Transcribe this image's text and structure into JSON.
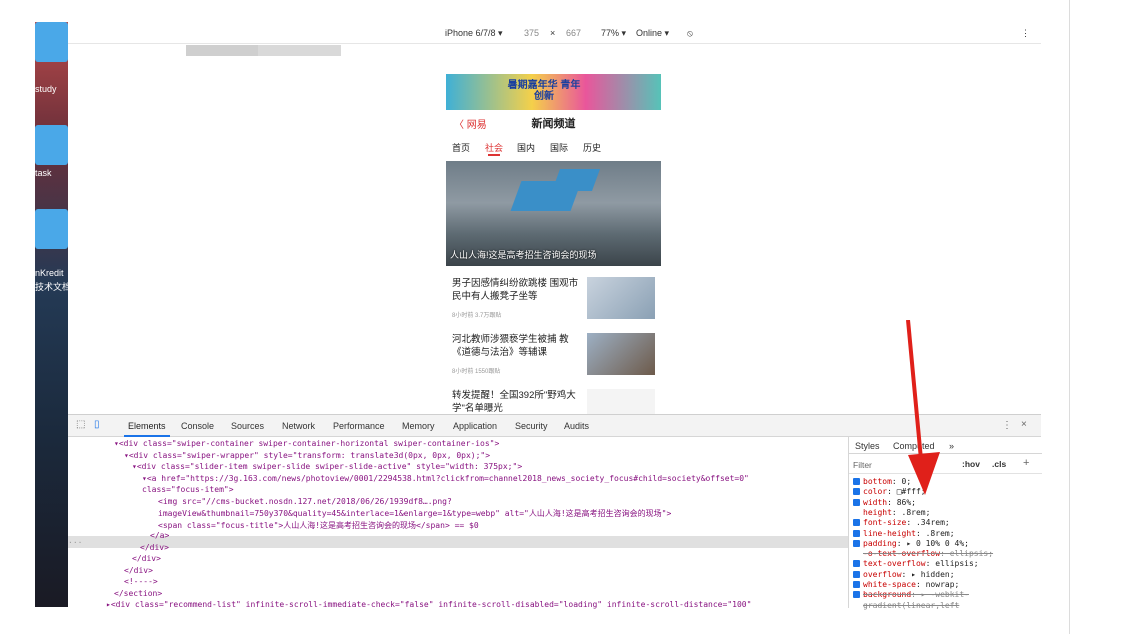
{
  "desktop": {
    "labels": [
      "study",
      "task",
      "nKredit",
      "技术文档"
    ]
  },
  "device_bar": {
    "device": "iPhone 6/7/8 ▾",
    "width": "375",
    "times": "×",
    "height": "667",
    "zoom": "77% ▾",
    "network": "Online ▾",
    "more": "⋮"
  },
  "phone": {
    "banner_text": "暑期嘉年华 青年创新",
    "back_label": "〈 网易",
    "title": "新闻频道",
    "tabs": [
      "首页",
      "社会",
      "国内",
      "国际",
      "历史"
    ],
    "active_tab": "社会",
    "hero_caption": "人山人海!这是高考招生咨询会的现场",
    "news": [
      {
        "title": "男子因感情纠纷欲跳楼 围观市民中有人搬凳子坐等",
        "meta": "8小时前  3.7万跟贴"
      },
      {
        "title": "河北教师涉猥亵学生被捕 教《道德与法治》等辅课",
        "meta": "8小时前  1550跟贴"
      },
      {
        "title": "转发提醒！全国392所\"野鸡大学\"名单曝光",
        "meta": ""
      }
    ]
  },
  "devtools": {
    "tabs": [
      "Elements",
      "Console",
      "Sources",
      "Network",
      "Performance",
      "Memory",
      "Application",
      "Security",
      "Audits"
    ],
    "active_tab": "Elements",
    "code_lines": [
      {
        "indent": 46,
        "html": "▾<div class=\"swiper-container swiper-container-horizontal swiper-container-ios\">"
      },
      {
        "indent": 56,
        "html": "▾<div class=\"swiper-wrapper\" style=\"transform: translate3d(0px, 0px, 0px);\">"
      },
      {
        "indent": 64,
        "html": "▾<div class=\"slider-item swiper-slide swiper-slide-active\" style=\"width: 375px;\">"
      },
      {
        "indent": 74,
        "html": "▾<a href=\"https://3g.163.com/news/photoview/0001/2294538.html?clickfrom=channel2018_news_society_focus#child=society&offset=0\""
      },
      {
        "indent": 74,
        "html": "class=\"focus-item\">"
      },
      {
        "indent": 90,
        "html": "<img src=\"//cms-bucket.nosdn.127.net/2018/06/26/1939df8….png?"
      },
      {
        "indent": 90,
        "html": "imageView&thumbnail=750y370&quality=45&interlace=1&enlarge=1&type=webp\" alt=\"人山人海!这是高考招生咨询会的现场\">"
      },
      {
        "indent": 90,
        "html": "<span class=\"focus-title\">人山人海!这是高考招生咨询会的现场</span> == $0"
      },
      {
        "indent": 82,
        "html": "</a>"
      },
      {
        "indent": 72,
        "html": "</div>"
      },
      {
        "indent": 64,
        "html": "</div>"
      },
      {
        "indent": 56,
        "html": "</div>"
      },
      {
        "indent": 56,
        "html": "<!---->"
      },
      {
        "indent": 46,
        "html": "</section>"
      },
      {
        "indent": 38,
        "html": "▸<div class=\"recommend-list\" infinite-scroll-immediate-check=\"false\" infinite-scroll-disabled=\"loading\" infinite-scroll-distance=\"100\""
      }
    ],
    "ellipsis": "...",
    "styles_tabs": [
      "Styles",
      "Computed",
      "»"
    ],
    "filter_placeholder": "Filter",
    "hov": ":hov",
    "cls": ".cls",
    "plus": "+",
    "rules": [
      {
        "prop": "bottom",
        "value": ": 0;",
        "checked": true,
        "struck": false
      },
      {
        "prop": "color",
        "value": ": □#fff;",
        "checked": true,
        "struck": false
      },
      {
        "prop": "width",
        "value": ": 86%;",
        "checked": true,
        "struck": false
      },
      {
        "prop": "height",
        "value": ": .8rem;",
        "checked": false,
        "struck": false
      },
      {
        "prop": "font-size",
        "value": ": .34rem;",
        "checked": true,
        "struck": false
      },
      {
        "prop": "line-height",
        "value": ": .8rem;",
        "checked": true,
        "struck": false
      },
      {
        "prop": "padding",
        "value": ": ▸ 0 10% 0 4%;",
        "checked": true,
        "struck": false
      },
      {
        "prop": "-o-text-overflow",
        "value": ": ellipsis;",
        "checked": false,
        "struck": true
      },
      {
        "prop": "text-overflow",
        "value": ": ellipsis;",
        "checked": true,
        "struck": false
      },
      {
        "prop": "overflow",
        "value": ": ▸ hidden;",
        "checked": true,
        "struck": false
      },
      {
        "prop": "white-space",
        "value": ": nowrap;",
        "checked": true,
        "struck": false
      },
      {
        "prop": "background",
        "value": ": ▸ -webkit-",
        "checked": true,
        "struck": true
      },
      {
        "prop": "",
        "value": "gradient(linear,left",
        "checked": false,
        "struck": true
      }
    ],
    "close": "×",
    "menu": "⋮"
  },
  "colors": {
    "accent": "#d33333",
    "arrow": "#e0201a",
    "devtools_blue": "#1a73e8"
  }
}
